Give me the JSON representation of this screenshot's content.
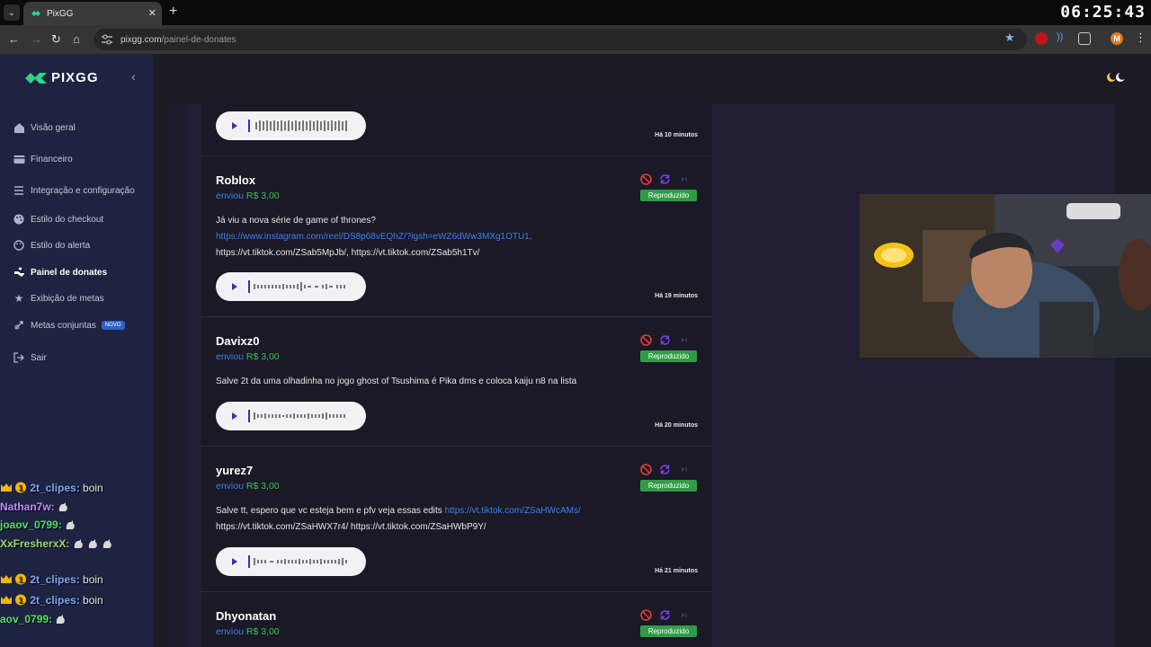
{
  "browser": {
    "tab_title": "PixGG",
    "url_host": "pixgg.com",
    "url_path": "/painel-de-donates",
    "clock": "06:25:43",
    "profile_initial": "M"
  },
  "sidebar": {
    "brand": "PIXGG",
    "items": [
      {
        "label": "Visão geral",
        "icon": "home-icon"
      },
      {
        "label": "Financeiro",
        "icon": "wallet-icon"
      },
      {
        "label": "Integração e configuração",
        "icon": "settings-list-icon"
      },
      {
        "label": "Estilo do checkout",
        "icon": "palette-icon"
      },
      {
        "label": "Estilo do alerta",
        "icon": "palette-icon"
      },
      {
        "label": "Painel de donates",
        "icon": "hand-heart-icon"
      },
      {
        "label": "Exibição de metas",
        "icon": "star-icon"
      },
      {
        "label": "Metas conjuntas",
        "icon": "target-icon",
        "badge": "NOVO"
      },
      {
        "label": "Sair",
        "icon": "logout-icon"
      }
    ],
    "active_index": 5
  },
  "chat": [
    {
      "user": "2t_clipes:",
      "msg": "boin",
      "color": "#7aa8ff",
      "crowns": true
    },
    {
      "user": "Nathan7w:",
      "msg": "",
      "color": "#c38bff",
      "cat": true
    },
    {
      "user": "joaov_0799:",
      "msg": "",
      "color": "#55e06a",
      "cat": true
    },
    {
      "user": "XxFresherxX:",
      "msg": "",
      "color": "#9fd96b",
      "cat": true
    },
    {
      "user": "2t_clipes:",
      "msg": "boin",
      "color": "#7aa8ff",
      "crowns": true
    },
    {
      "user": "2t_clipes:",
      "msg": "boin",
      "color": "#7aa8ff",
      "crowns": true
    },
    {
      "user": "aov_0799:",
      "msg": "",
      "color": "#55e06a",
      "cat": true
    }
  ],
  "donations": [
    {
      "name": "",
      "time": "Há 10 minutos"
    },
    {
      "name": "Roblox",
      "sent_label": "enviou",
      "amount": "R$ 3,00",
      "status": "Reproduzido",
      "text_line1": "Já viu a nova série de game of thrones?",
      "link1": "https://www.instagram.com/reel/DS8p68vEQhZ/?igsh=eWZ6dWw3MXg1OTU1,",
      "text_line3": "https://vt.tiktok.com/ZSab5MpJb/, https://vt.tiktok.com/ZSab5h1Tv/",
      "time": "Há 19 minutos"
    },
    {
      "name": "Davixz0",
      "sent_label": "enviou",
      "amount": "R$ 3,00",
      "status": "Reproduzido",
      "text_line1": "Salve 2t da uma olhadinha no jogo ghost of Tsushima é Pika dms e coloca kaiju n8 na lista",
      "time": "Há 20 minutos"
    },
    {
      "name": "yurez7",
      "sent_label": "enviou",
      "amount": "R$ 3,00",
      "status": "Reproduzido",
      "text_pre": "Salve tt, espero que vc esteja bem e pfv veja essas edits ",
      "link1": "https://vt.tiktok.com/ZSaHWcAMs/",
      "text_line2": "https://vt.tiktok.com/ZSaHWX7r4/ https://vt.tiktok.com/ZSaHWbP9Y/",
      "time": "Há 21 minutos"
    },
    {
      "name": "Dhyonatan",
      "sent_label": "enviou",
      "amount": "R$ 3,00",
      "status": "Reproduzido"
    }
  ],
  "colors": {
    "accent_blue": "#3c7ff0",
    "amount_green": "#3bbf5e",
    "status_green": "#2f9d46",
    "sidebar_bg": "#1d2340"
  }
}
